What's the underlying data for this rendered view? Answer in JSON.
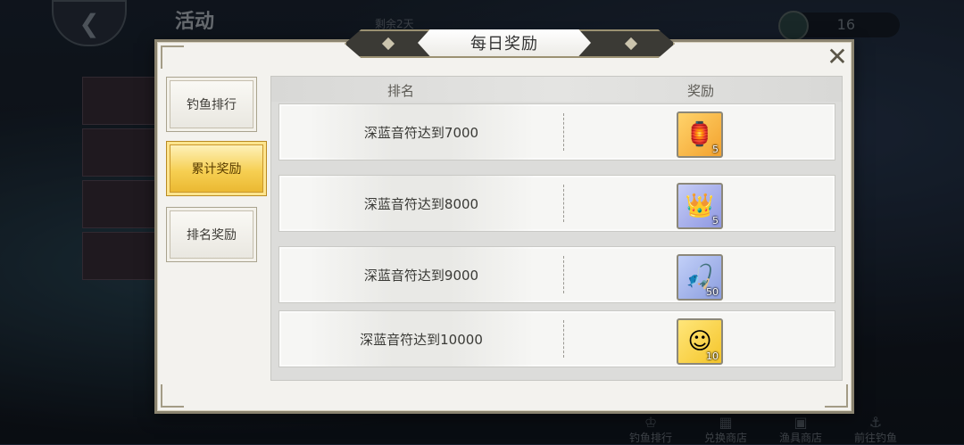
{
  "background": {
    "title": "活动",
    "subtitle": "剩余2天",
    "currency_value": "16",
    "bottom_nav": [
      {
        "label": "钓鱼排行",
        "icon": "trophy-icon"
      },
      {
        "label": "兑换商店",
        "icon": "shop-icon"
      },
      {
        "label": "渔具商店",
        "icon": "store-icon"
      },
      {
        "label": "前往钓鱼",
        "icon": "fishing-icon"
      }
    ]
  },
  "dialog": {
    "title": "每日奖励",
    "close_icon": "close-icon"
  },
  "tabs": [
    {
      "label": "钓鱼排行",
      "active": false
    },
    {
      "label": "累计奖励",
      "active": true
    },
    {
      "label": "排名奖励",
      "active": false
    }
  ],
  "table": {
    "headers": {
      "rank": "排名",
      "reward": "奖励"
    },
    "rows": [
      {
        "condition": "深蓝音符达到7000",
        "reward_icon": "lantern-icon",
        "count": "5"
      },
      {
        "condition": "深蓝音符达到8000",
        "reward_icon": "golden-hat-icon",
        "count": "5"
      },
      {
        "condition": "深蓝音符达到9000",
        "reward_icon": "fishing-rod-icon",
        "count": "50"
      },
      {
        "condition": "深蓝音符达到10000",
        "reward_icon": "character-portrait-icon",
        "count": "10"
      }
    ]
  },
  "colors": {
    "active_tab": "#f6cf52",
    "dialog_bg": "#f3f2ee",
    "frame": "#8b8470"
  }
}
